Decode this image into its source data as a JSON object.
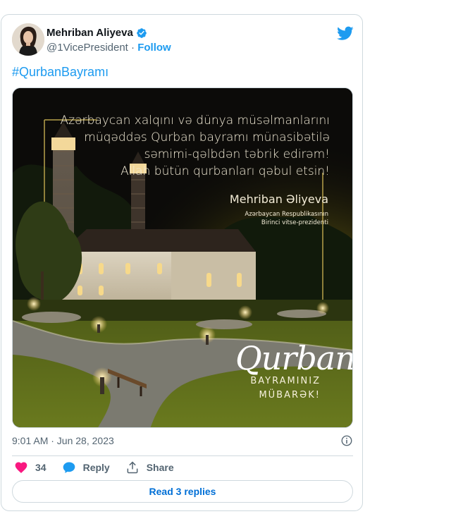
{
  "author": {
    "display_name": "Mehriban Aliyeva",
    "handle": "@1VicePresident",
    "separator": "·",
    "follow_label": "Follow"
  },
  "tweet": {
    "text": "#QurbanBayramı",
    "image": {
      "greeting_lines": [
        "Azərbaycan xalqını və dünya müsəlmanlarını",
        "müqəddəs Qurban bayramı münasibətilə",
        "səmimi-qəlbdən təbrik edirəm!",
        "Allah bütün qurbanları qəbul etsin!"
      ],
      "signer_name": "Mehriban Əliyeva",
      "signer_title_1": "Azərbaycan Respublikasının",
      "signer_title_2": "Birinci vitse-prezidenti",
      "qurban_word": "Qurban",
      "bayram_word": "BAYRAMINIZ",
      "mubarek_word": "MÜBARƏK!"
    },
    "timestamp": "9:01 AM · Jun 28, 2023"
  },
  "actions": {
    "like_count": "34",
    "reply_label": "Reply",
    "share_label": "Share",
    "read_replies_label": "Read 3 replies"
  },
  "colors": {
    "link_blue": "#1d9bf0",
    "like_pink": "#f91880",
    "text_gray": "#536471",
    "border": "#cfd9de"
  },
  "icons": [
    "verified-badge-icon",
    "twitter-bird-icon",
    "info-icon",
    "heart-icon",
    "reply-bubble-icon",
    "share-icon"
  ]
}
